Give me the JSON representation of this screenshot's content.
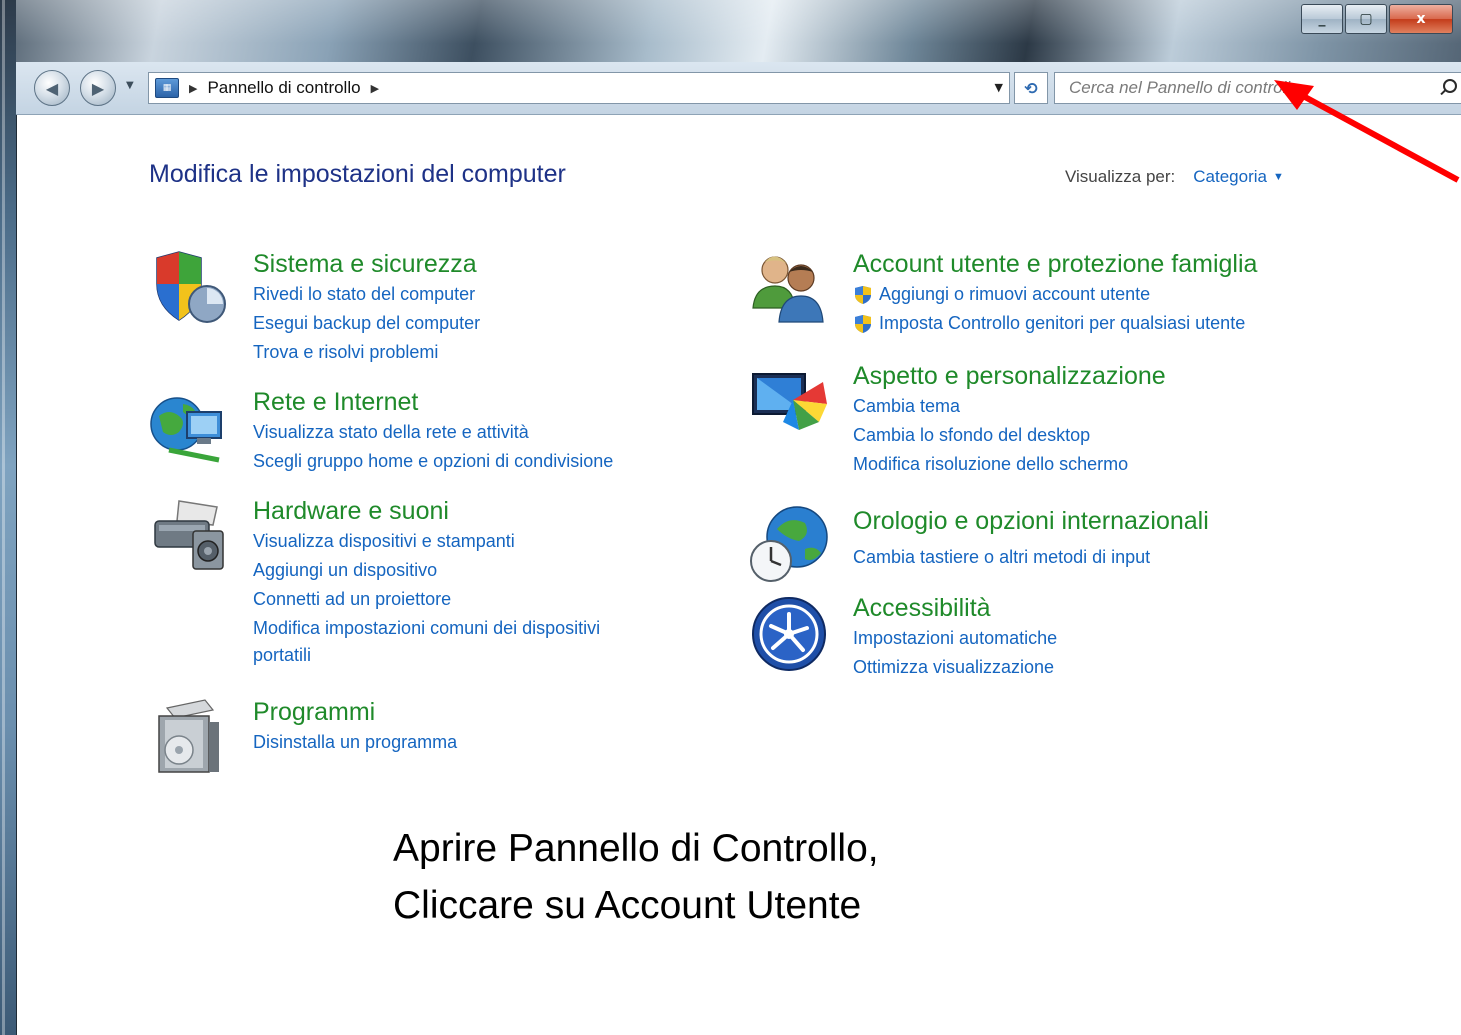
{
  "window": {
    "controls": {
      "minimize": "_",
      "maximize": "▢",
      "close": "x"
    }
  },
  "nav": {
    "back_icon": "back-arrow-icon",
    "forward_icon": "forward-arrow-icon",
    "breadcrumb": [
      "Pannello di controllo"
    ],
    "search_placeholder": "Cerca nel Pannello di controllo"
  },
  "header": {
    "title": "Modifica le impostazioni del computer",
    "view_by_label": "Visualizza per:",
    "view_by_value": "Categoria"
  },
  "categories": [
    {
      "title": "Sistema e sicurezza",
      "icon": "shield-icon",
      "links": [
        "Rivedi lo stato del computer",
        "Esegui backup del computer",
        "Trova e risolvi problemi"
      ]
    },
    {
      "title": "Rete e Internet",
      "icon": "network-globe-icon",
      "links": [
        "Visualizza stato della rete e attività",
        "Scegli gruppo home e opzioni di condivisione"
      ]
    },
    {
      "title": "Hardware e suoni",
      "icon": "printer-speaker-icon",
      "links": [
        "Visualizza dispositivi e stampanti",
        "Aggiungi un dispositivo",
        "Connetti ad un proiettore",
        "Modifica impostazioni comuni dei dispositivi",
        "portatili"
      ]
    },
    {
      "title": "Programmi",
      "icon": "programs-box-icon",
      "links": [
        "Disinstalla un programma"
      ]
    },
    {
      "title": "Account utente e protezione famiglia",
      "icon": "users-icon",
      "links": [
        "Aggiungi o rimuovi account utente",
        "Imposta Controllo genitori per qualsiasi utente"
      ]
    },
    {
      "title": "Aspetto e personalizzazione",
      "icon": "monitor-palette-icon",
      "links": [
        "Cambia tema",
        "Cambia lo sfondo del desktop",
        "Modifica risoluzione dello schermo"
      ]
    },
    {
      "title": "Orologio e opzioni internazionali",
      "icon": "clock-globe-icon",
      "links": [
        "Cambia tastiere o altri metodi di input"
      ]
    },
    {
      "title": "Accessibilità",
      "icon": "accessibility-icon",
      "links": [
        "Impostazioni automatiche",
        "Ottimizza visualizzazione"
      ]
    }
  ],
  "caption": {
    "line1": "Aprire Pannello di Controllo,",
    "line2": "Cliccare su Account Utente"
  },
  "annotation": {
    "arrow_color": "#ff0000"
  }
}
